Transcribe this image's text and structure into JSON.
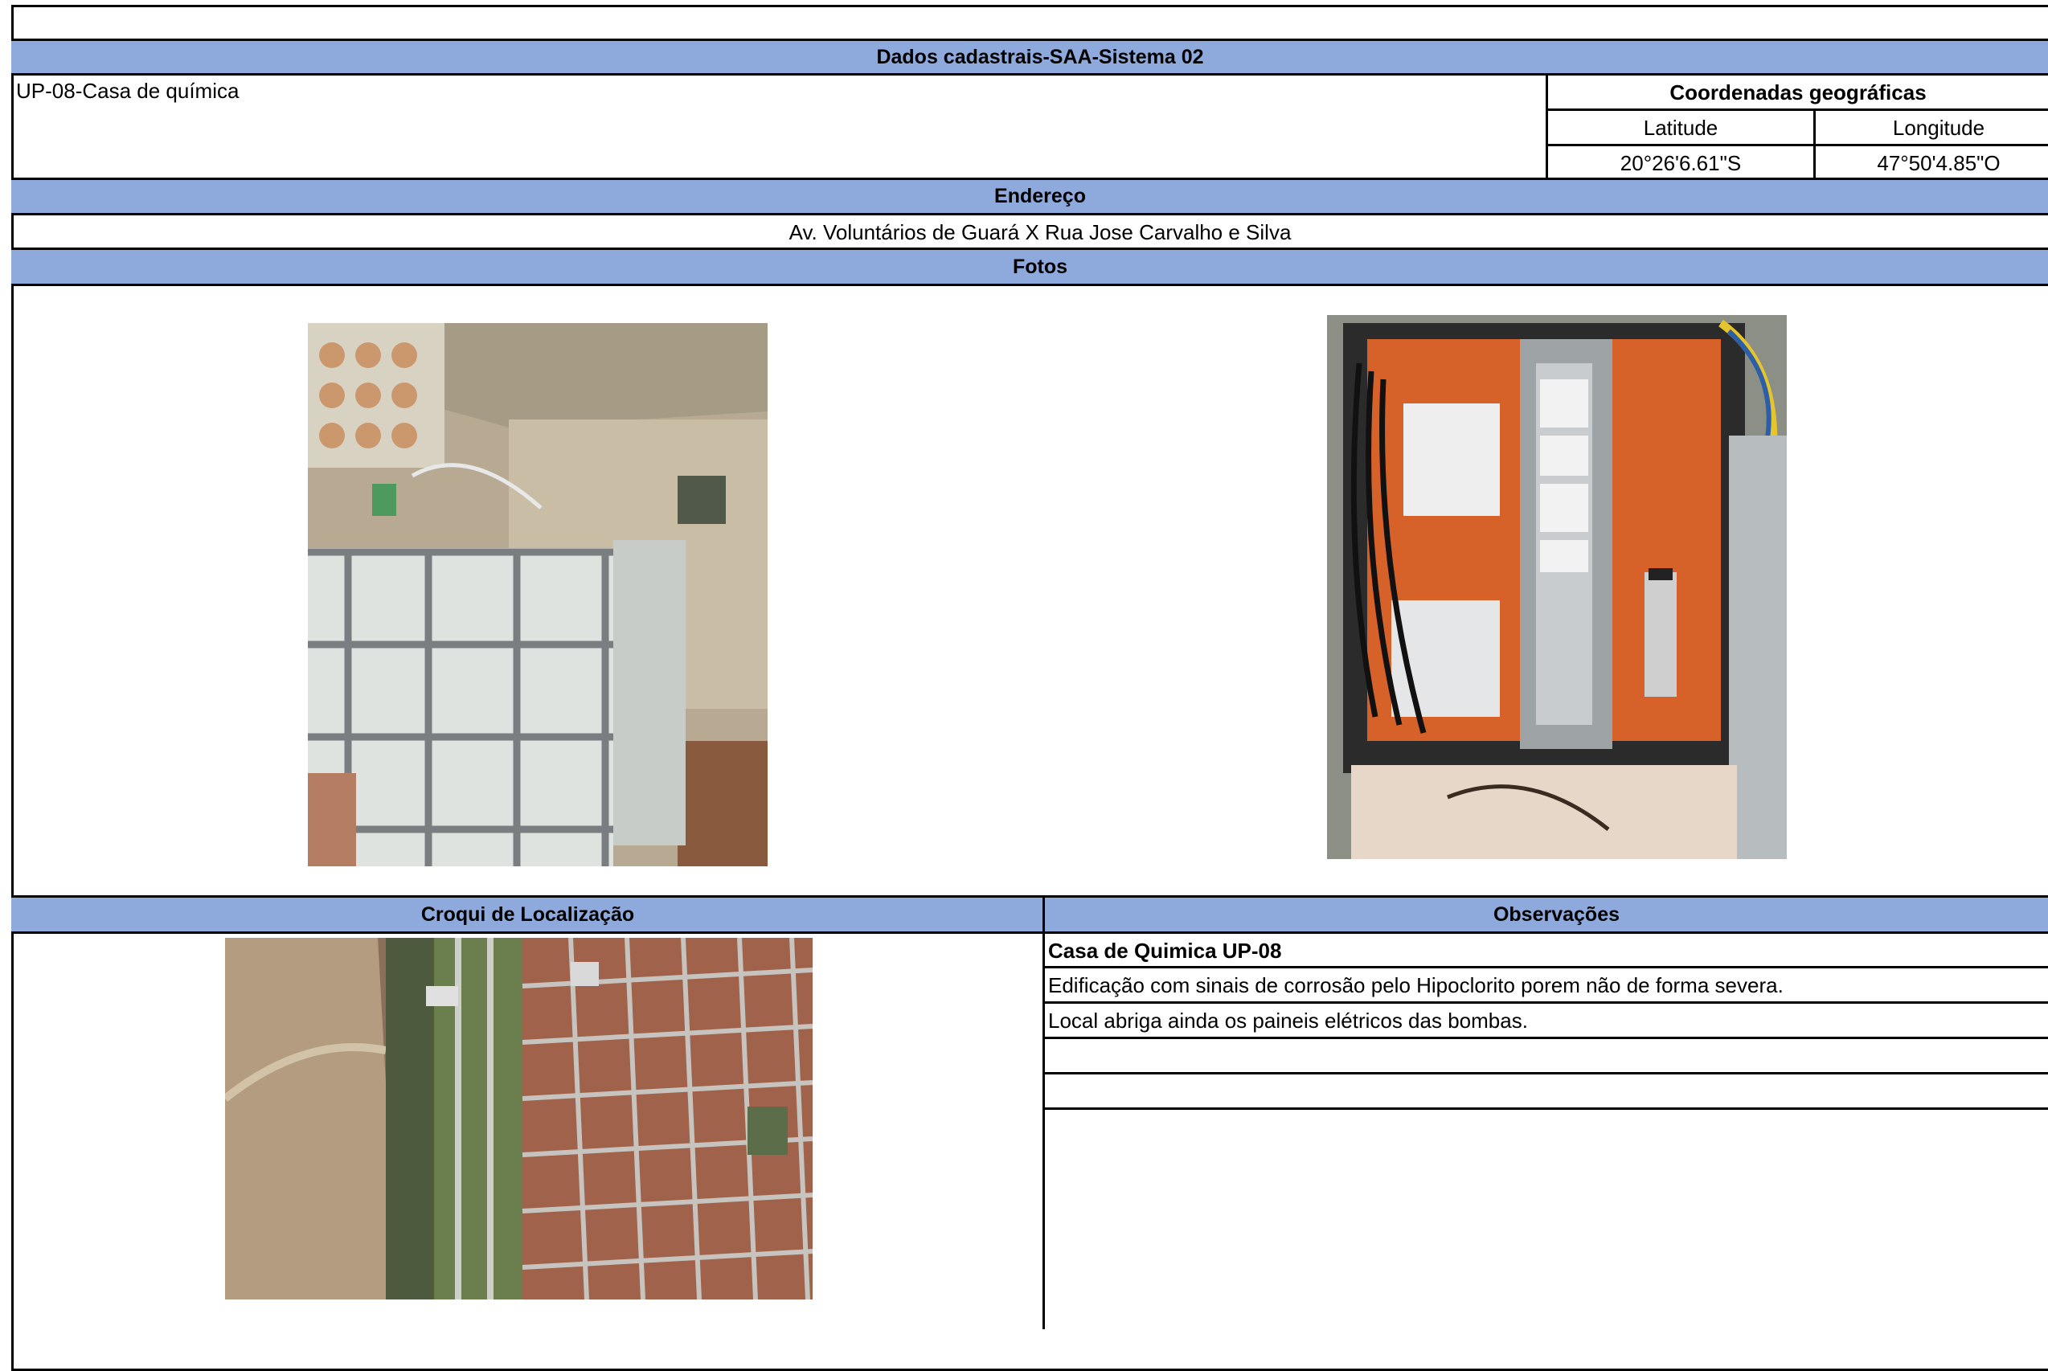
{
  "sheet": {
    "title": "Dados cadastrais-SAA-Sistema 02",
    "unit_name": "UP-08-Casa de química",
    "coordinates": {
      "heading": "Coordenadas geográficas",
      "latitude_label": "Latitude",
      "longitude_label": "Longitude",
      "latitude_value": "20°26'6.61\"S",
      "longitude_value": "47°50'4.85\"O"
    },
    "address": {
      "heading": "Endereço",
      "value": "Av. Voluntários de Guará X Rua Jose Carvalho e Silva"
    },
    "photos": {
      "heading": "Fotos",
      "items": [
        "chemical-tank-room-photo",
        "electrical-panel-photo"
      ]
    },
    "location": {
      "heading": "Croqui de Localização",
      "image": "satellite-map-image"
    },
    "observations": {
      "heading": "Observações",
      "lines": [
        "Casa de Quimica UP-08",
        "Edificação com sinais de corrosão pelo Hipoclorito porem não de forma severa.",
        "Local abriga ainda os paineis elétricos das bombas.",
        "",
        ""
      ]
    }
  }
}
